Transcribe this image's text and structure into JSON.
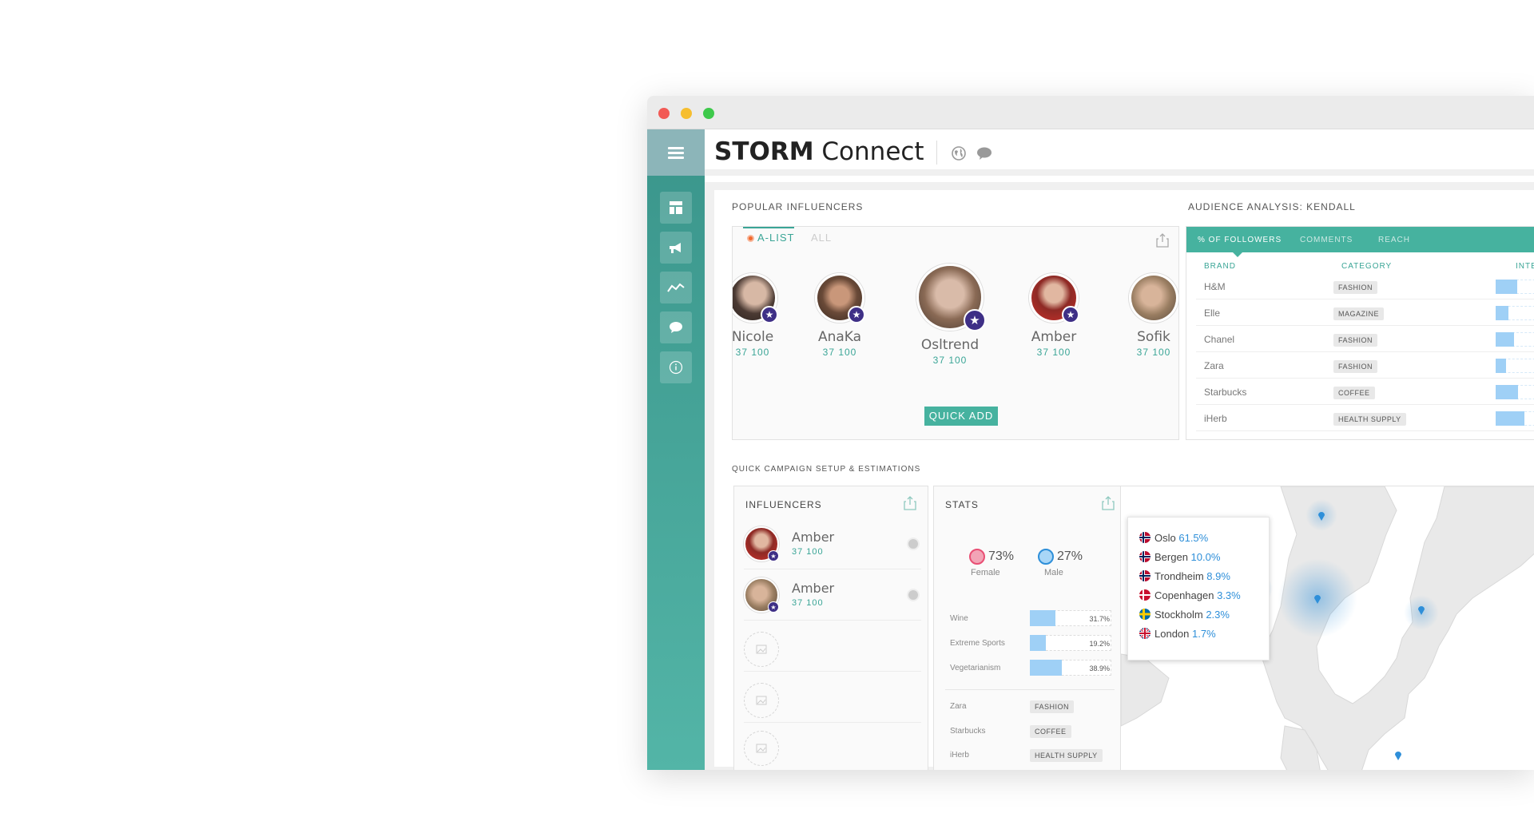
{
  "app": {
    "brand_bold": "STORM",
    "brand_light": "Connect"
  },
  "popular": {
    "title": "POPULAR INFLUENCERS",
    "tab_alist": "A-LIST",
    "tab_all": "ALL",
    "quick_add": "QUICK ADD",
    "influencers": [
      {
        "name": "Nicole",
        "count": "37 100"
      },
      {
        "name": "AnaKa",
        "count": "37 100"
      },
      {
        "name": "Osltrend",
        "count": "37 100"
      },
      {
        "name": "Amber",
        "count": "37 100"
      },
      {
        "name": "Sofik",
        "count": "37 100"
      }
    ]
  },
  "audience": {
    "title": "AUDIENCE ANALYSIS: KENDALL",
    "tabs": [
      "% OF FOLLOWERS",
      "COMMENTS",
      "REACH"
    ],
    "col_brand": "BRAND",
    "col_category": "CATEGORY",
    "col_interest": "INTE",
    "rows": [
      {
        "brand": "H&M",
        "category": "FASHION",
        "interest": 0.45
      },
      {
        "brand": "Elle",
        "category": "MAGAZINE",
        "interest": 0.27
      },
      {
        "brand": "Chanel",
        "category": "FASHION",
        "interest": 0.38
      },
      {
        "brand": "Zara",
        "category": "FASHION",
        "interest": 0.22
      },
      {
        "brand": "Starbucks",
        "category": "COFFEE",
        "interest": 0.47
      },
      {
        "brand": "iHerb",
        "category": "HEALTH SUPPLY",
        "interest": 0.6
      }
    ]
  },
  "campaign": {
    "title": "QUICK CAMPAIGN SETUP & ESTIMATIONS",
    "influencers_title": "INFLUENCERS",
    "influencers": [
      {
        "name": "Amber",
        "count": "37 100"
      },
      {
        "name": "Amber",
        "count": "37 100"
      }
    ],
    "stats_title": "STATS",
    "female_pct": "73%",
    "female_label": "Female",
    "male_pct": "27%",
    "male_label": "Male",
    "interests": [
      {
        "label": "Wine",
        "pct": "31.7%",
        "value": 31.7
      },
      {
        "label": "Extreme Sports",
        "pct": "19.2%",
        "value": 19.2
      },
      {
        "label": "Vegetarianism",
        "pct": "38.9%",
        "value": 38.9
      }
    ],
    "brands": [
      {
        "brand": "Zara",
        "category": "FASHION"
      },
      {
        "brand": "Starbucks",
        "category": "COFFEE"
      },
      {
        "brand": "iHerb",
        "category": "HEALTH SUPPLY"
      }
    ]
  },
  "map": {
    "cities": [
      {
        "city": "Oslo",
        "pct": "61.5%",
        "flag": "no"
      },
      {
        "city": "Bergen",
        "pct": "10.0%",
        "flag": "no"
      },
      {
        "city": "Trondheim",
        "pct": "8.9%",
        "flag": "no"
      },
      {
        "city": "Copenhagen",
        "pct": "3.3%",
        "flag": "dk"
      },
      {
        "city": "Stockholm",
        "pct": "2.3%",
        "flag": "se"
      },
      {
        "city": "London",
        "pct": "1.7%",
        "flag": "gb"
      }
    ]
  },
  "colors": {
    "accent": "#46b29f",
    "bar": "#9fd0f6",
    "badge": "#3e2f86"
  }
}
